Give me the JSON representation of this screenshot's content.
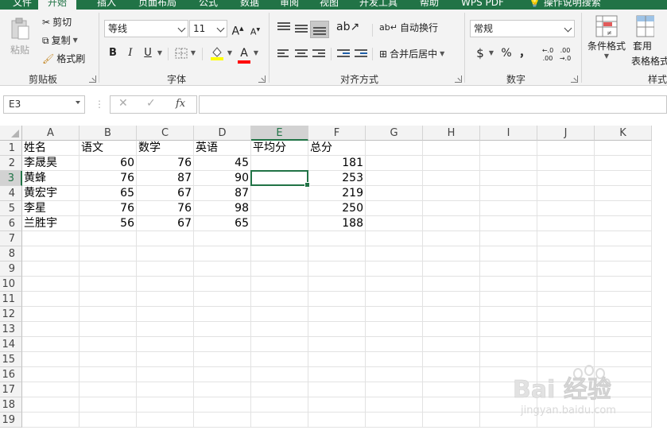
{
  "ribbon_tabs": [
    {
      "label": "文件"
    },
    {
      "label": "开始"
    },
    {
      "label": "插入"
    },
    {
      "label": "页面布局"
    },
    {
      "label": "公式"
    },
    {
      "label": "数据"
    },
    {
      "label": "审阅"
    },
    {
      "label": "视图"
    },
    {
      "label": "开发工具"
    },
    {
      "label": "帮助"
    },
    {
      "label": "WPS PDF"
    },
    {
      "label": "操作说明搜索"
    }
  ],
  "clipboard": {
    "paste_label": "粘贴",
    "cut_label": "剪切",
    "copy_label": "复制",
    "format_painter_label": "格式刷",
    "group_label": "剪贴板"
  },
  "font": {
    "font_name": "等线",
    "font_size": "11",
    "bold": "B",
    "italic": "I",
    "underline": "U",
    "increase_size": "A",
    "decrease_size": "A",
    "font_color_letter": "A",
    "group_label": "字体",
    "highlight_color": "#ffff00",
    "font_color": "#ff0000"
  },
  "alignment": {
    "wrap_text_label": "自动换行",
    "merge_center_label": "合并后居中",
    "group_label": "对齐方式"
  },
  "number": {
    "format": "常规",
    "currency_symbol": "$",
    "percent_symbol": "%",
    "comma_symbol": "，",
    "inc_decimal": "←.0 .00",
    "dec_decimal": ".00 →.0",
    "group_label": "数字"
  },
  "styles": {
    "conditional_format_label": "条件格式",
    "format_as_table_label_1": "套用",
    "format_as_table_label_2": "表格格式",
    "group_label": "样式"
  },
  "formula_bar": {
    "name_box": "E3",
    "cancel_icon": "✕",
    "enter_icon": "✓",
    "fx_label": "fx",
    "content": ""
  },
  "sheet": {
    "columns": [
      "A",
      "B",
      "C",
      "D",
      "E",
      "F",
      "G",
      "H",
      "I",
      "J",
      "K"
    ],
    "rows": [
      "1",
      "2",
      "3",
      "4",
      "5",
      "6",
      "7",
      "8",
      "9",
      "10",
      "11",
      "12",
      "13",
      "14",
      "15",
      "16",
      "17",
      "18",
      "19"
    ],
    "selected_cell": "E3",
    "header_row": [
      "姓名",
      "语文",
      "数学",
      "英语",
      "平均分",
      "总分"
    ],
    "data_rows": [
      [
        "李晟昊",
        "60",
        "76",
        "45",
        "",
        "181"
      ],
      [
        "黄蜂",
        "76",
        "87",
        "90",
        "",
        "253"
      ],
      [
        "黄宏宇",
        "65",
        "67",
        "87",
        "",
        "219"
      ],
      [
        "李星",
        "76",
        "76",
        "98",
        "",
        "250"
      ],
      [
        "兰胜宇",
        "56",
        "67",
        "65",
        "",
        "188"
      ]
    ]
  },
  "watermark": {
    "brand": "Bai 经验",
    "url": "jingyan.baidu.com"
  },
  "colors": {
    "excel_green": "#217346",
    "ribbon_bg": "#f3f3f3"
  }
}
